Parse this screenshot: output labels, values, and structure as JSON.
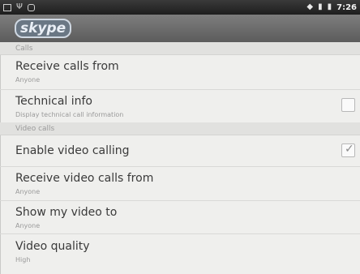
{
  "status_bar": {
    "time": "7:26",
    "icons": [
      "image-icon",
      "usb-icon",
      "sync-icon",
      "wifi-icon",
      "signal-icon",
      "battery-icon"
    ]
  },
  "app_bar": {
    "logo_text": "skype"
  },
  "settings": {
    "calls_header": "Calls",
    "receive_calls_from": {
      "title": "Receive calls from",
      "value": "Anyone"
    },
    "technical_info": {
      "title": "Technical info",
      "summary": "Display technical call information",
      "checked": false
    },
    "video_calls_header": "Video calls",
    "enable_video_calling": {
      "title": "Enable video calling",
      "checked": true
    },
    "receive_video_calls_from": {
      "title": "Receive video calls from",
      "value": "Anyone"
    },
    "show_my_video_to": {
      "title": "Show my video to",
      "value": "Anyone"
    },
    "video_quality": {
      "title": "Video quality",
      "value": "High"
    }
  }
}
